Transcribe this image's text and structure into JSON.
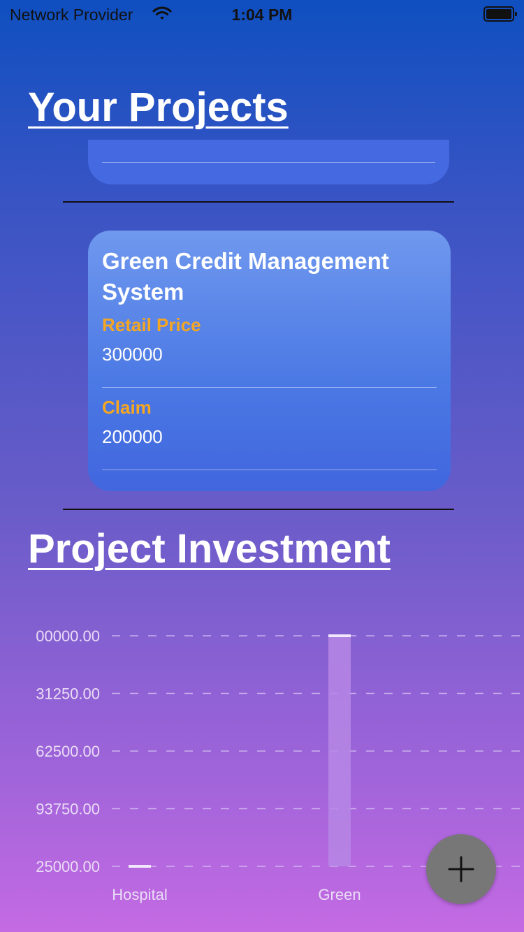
{
  "status_bar": {
    "carrier": "Network Provider",
    "time": "1:04 PM"
  },
  "sections": {
    "projects_title": "Your Projects",
    "investment_title": "Project Investment"
  },
  "project_card": {
    "name": "Green Credit Management System",
    "retail_price_label": "Retail Price",
    "retail_price_value": "300000",
    "claim_label": "Claim",
    "claim_value": "200000"
  },
  "chart_data": {
    "type": "bar",
    "categories": [
      "Hospital",
      "Green"
    ],
    "values": [
      25000,
      300000
    ],
    "y_tick_labels": [
      "25000.00",
      "93750.00",
      "62500.00",
      "31250.00",
      "00000.00"
    ],
    "ylim": [
      25000,
      300000
    ],
    "grid": "dashed horizontal",
    "colors": {
      "bar": "#b687e5",
      "cap": "#f2e8fb",
      "text": "#eadcf6",
      "grid": "#d8c4f3"
    }
  },
  "fab": {
    "icon": "plus-icon"
  }
}
